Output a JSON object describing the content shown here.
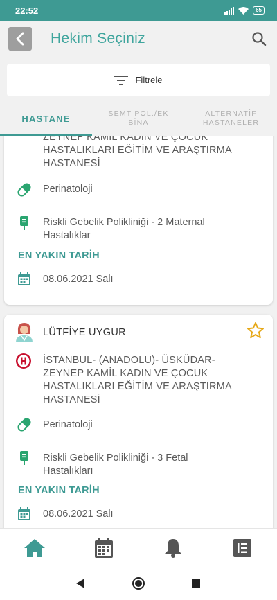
{
  "status_bar": {
    "time": "22:52",
    "battery": "65"
  },
  "header": {
    "title": "Hekim Seçiniz"
  },
  "filter": {
    "label": "Filtrele"
  },
  "tabs": [
    {
      "line1": "HASTANE",
      "line2": ""
    },
    {
      "line1": "SEMT POL./EK",
      "line2": "BİNA"
    },
    {
      "line1": "ALTERNATİF",
      "line2": "HASTANELER"
    }
  ],
  "cards": [
    {
      "hospital_lines": [
        "ZEYNEP KAMİL KADIN VE ÇOCUK",
        "HASTALIKLARI EĞİTİM VE ARAŞTIRMA",
        "HASTANESİ"
      ],
      "department": "Perinatoloji",
      "clinic_lines": [
        "Riskli Gebelik Polikliniği - 2  Maternal",
        "Hastalıklar"
      ],
      "nearest_label": "EN YAKIN TARİH",
      "date": "08.06.2021 Salı"
    },
    {
      "doctor": "LÜTFİYE UYGUR",
      "hospital_lines": [
        "İSTANBUL- (ANADOLU)- ÜSKÜDAR-",
        "ZEYNEP KAMİL KADIN VE ÇOCUK",
        "HASTALIKLARI EĞİTİM VE ARAŞTIRMA",
        "HASTANESİ"
      ],
      "department": "Perinatoloji",
      "clinic_lines": [
        "Riskli Gebelik Polikliniği - 3  Fetal",
        "Hastalıkları"
      ],
      "nearest_label": "EN YAKIN TARİH",
      "date": "08.06.2021 Salı"
    }
  ],
  "colors": {
    "accent": "#3e9a93",
    "hospital_red": "#c8102e",
    "star": "#e6a817"
  }
}
